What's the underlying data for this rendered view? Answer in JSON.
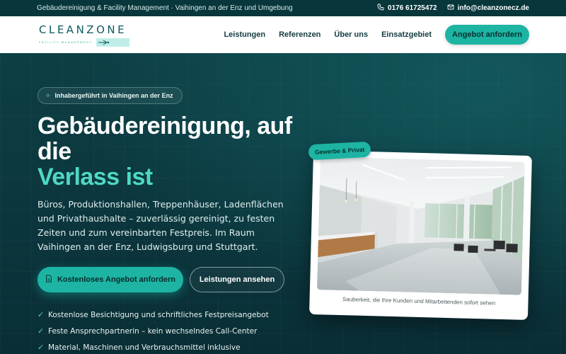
{
  "topbar": {
    "tagline": "Gebäudereinigung & Facility Management · Vaihingen an der Enz und Umgebung",
    "phone": "0176 61725472",
    "email": "info@cleanzonecz.de"
  },
  "header": {
    "logo_wordmark": "CLEANZONE",
    "logo_subtitle": "FACILITY MANAGEMENT",
    "nav": [
      "Leistungen",
      "Referenzen",
      "Über uns",
      "Einsatzgebiet"
    ],
    "cta_label": "Angebot anfordern"
  },
  "hero": {
    "badge": "Inhabergeführt in Vaihingen an der Enz",
    "headline_line1": "Gebäudereinigung, auf",
    "headline_line2": "die",
    "headline_accent": "Verlass ist",
    "lead": "Büros, Produktionshallen, Treppenhäuser, Ladenflächen und Privathaushalte – zuverlässig gereinigt, zu festen Zeiten und zum vereinbarten Festpreis. Im Raum Vaihingen an der Enz, Ludwigsburg und Stuttgart.",
    "primary_button": "Kostenloses Angebot anfordern",
    "secondary_button": "Leistungen ansehen",
    "checklist": [
      "Kostenlose Besichtigung und schriftliches Festpreisangebot",
      "Feste Ansprechpartnerin – kein wechselndes Call-Center",
      "Material, Maschinen und Verbrauchsmittel inklusive"
    ],
    "image_tag": "Gewerbe & Privat",
    "image_caption": "Sauberkeit, die Ihre Kunden und Mitarbeitenden sofort sehen"
  },
  "colors": {
    "accent": "#1db4a3",
    "accent_text": "#4fd8c4",
    "hero_bg": "#0c3a40",
    "topbar_bg": "#07363b"
  }
}
